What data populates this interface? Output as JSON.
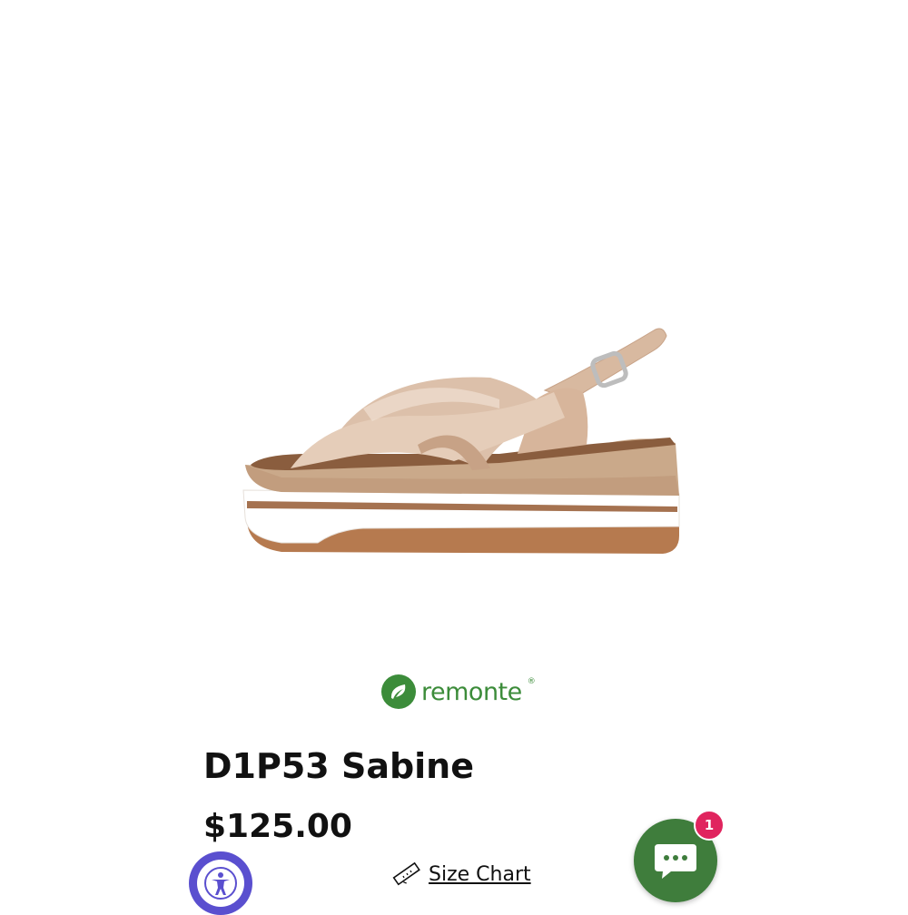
{
  "brand": {
    "name": "remonte",
    "registered": "®",
    "color": "#3c8c3a"
  },
  "product": {
    "title": "D1P53 Sabine",
    "price": "$125.00",
    "image_icon": "sandal-image"
  },
  "size_chart": {
    "label": "Size Chart",
    "icon": "ruler-icon"
  },
  "accessibility": {
    "icon": "accessibility-icon",
    "color": "#5a4fcf"
  },
  "chat": {
    "icon": "chat-bubble-icon",
    "badge_count": "1",
    "color": "#3f7d3c",
    "badge_color": "#e0245e"
  }
}
